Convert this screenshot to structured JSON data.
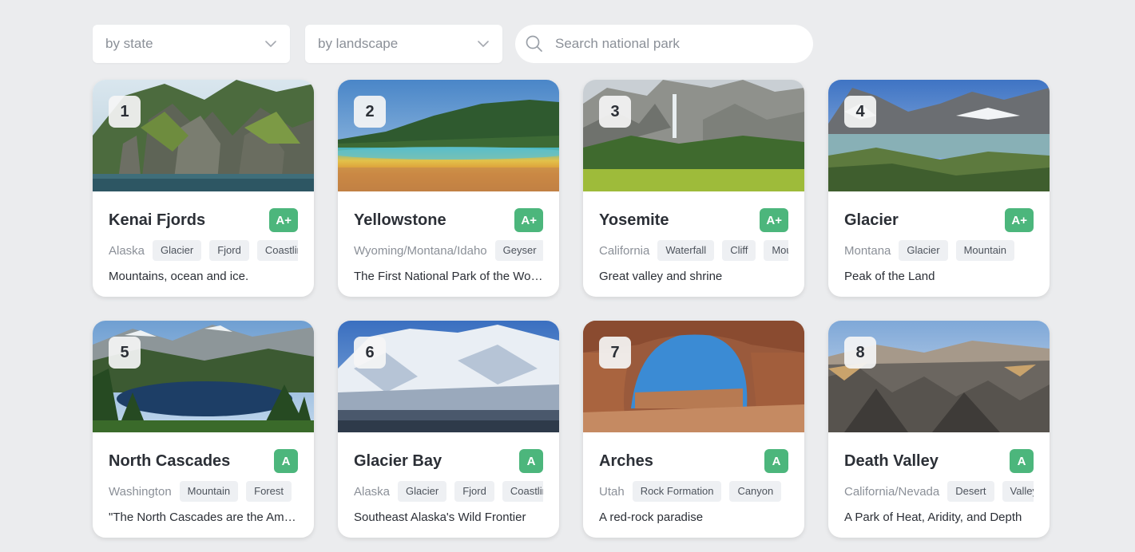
{
  "filters": {
    "state_select": "by state",
    "landscape_select": "by landscape",
    "search_placeholder": "Search national park",
    "search_value": ""
  },
  "colors": {
    "grade_green": "#4cb67c",
    "page_bg": "#ebecee"
  },
  "parks": [
    {
      "rank": "1",
      "name": "Kenai Fjords",
      "grade": "A+",
      "state": "Alaska",
      "tags": [
        "Glacier",
        "Fjord",
        "Coastline"
      ],
      "description": "Mountains, ocean and ice."
    },
    {
      "rank": "2",
      "name": "Yellowstone",
      "grade": "A+",
      "state": "Wyoming/Montana/Idaho",
      "tags": [
        "Geyser"
      ],
      "description": "The First National Park of the World"
    },
    {
      "rank": "3",
      "name": "Yosemite",
      "grade": "A+",
      "state": "California",
      "tags": [
        "Waterfall",
        "Cliff",
        "Mountain"
      ],
      "description": "Great valley and shrine"
    },
    {
      "rank": "4",
      "name": "Glacier",
      "grade": "A+",
      "state": "Montana",
      "tags": [
        "Glacier",
        "Mountain"
      ],
      "description": "Peak of the Land"
    },
    {
      "rank": "5",
      "name": "North Cascades",
      "grade": "A",
      "state": "Washington",
      "tags": [
        "Mountain",
        "Forest"
      ],
      "description": "\"The North Cascades are the American Alps\""
    },
    {
      "rank": "6",
      "name": "Glacier Bay",
      "grade": "A",
      "state": "Alaska",
      "tags": [
        "Glacier",
        "Fjord",
        "Coastline"
      ],
      "description": "Southeast Alaska's Wild Frontier"
    },
    {
      "rank": "7",
      "name": "Arches",
      "grade": "A",
      "state": "Utah",
      "tags": [
        "Rock Formation",
        "Canyon"
      ],
      "description": "A red-rock paradise"
    },
    {
      "rank": "8",
      "name": "Death Valley",
      "grade": "A",
      "state": "California/Nevada",
      "tags": [
        "Desert",
        "Valley"
      ],
      "description": "A Park of Heat, Aridity, and Depth"
    }
  ]
}
